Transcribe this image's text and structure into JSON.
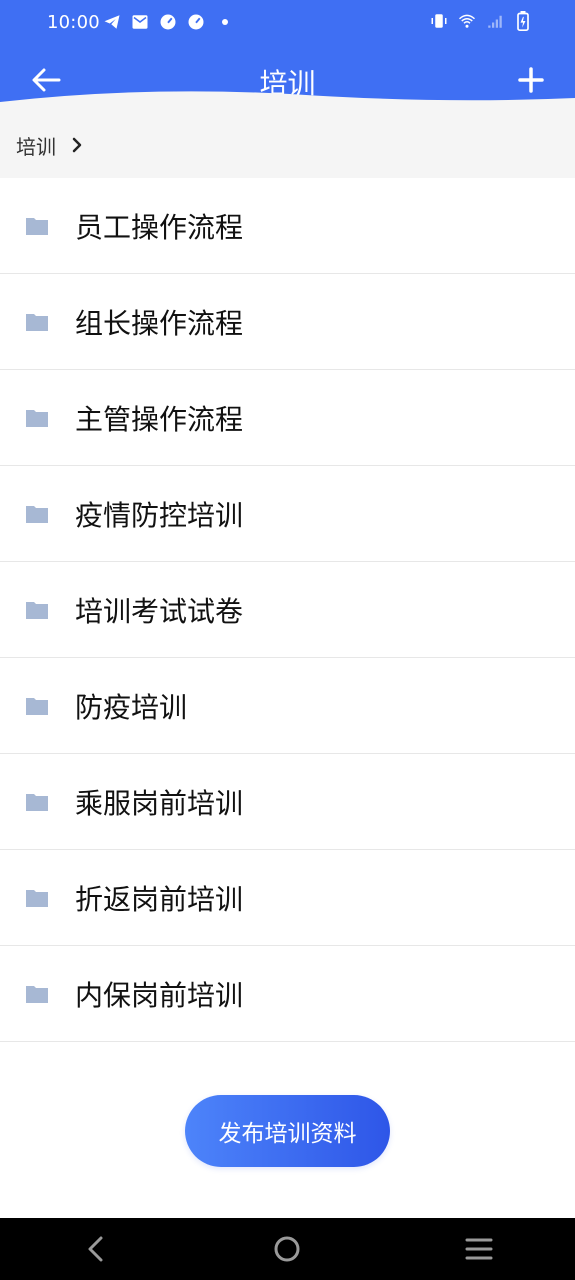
{
  "status_bar": {
    "time": "10:00",
    "left_icons": [
      "telegram-icon",
      "mail-icon",
      "speedometer-icon",
      "speedometer-icon-2",
      "dot-icon"
    ],
    "right_icons": [
      "vibrate-icon",
      "wifi-icon",
      "signal-icon",
      "battery-icon"
    ]
  },
  "header": {
    "title": "培训",
    "background": "#3f6ff3"
  },
  "breadcrumb": {
    "label": "培训"
  },
  "list": {
    "items": [
      {
        "label": "员工操作流程"
      },
      {
        "label": "组长操作流程"
      },
      {
        "label": "主管操作流程"
      },
      {
        "label": "疫情防控培训"
      },
      {
        "label": "培训考试试卷"
      },
      {
        "label": "防疫培训"
      },
      {
        "label": "乘服岗前培训"
      },
      {
        "label": "折返岗前培训"
      },
      {
        "label": "内保岗前培训"
      }
    ]
  },
  "publish_button": {
    "label": "发布培训资料"
  },
  "navbar": {
    "icons": [
      "back-nav-icon",
      "home-nav-icon",
      "recents-nav-icon"
    ]
  },
  "colors": {
    "accent": "#3f6ff3",
    "folder": "#a7b8d4"
  }
}
